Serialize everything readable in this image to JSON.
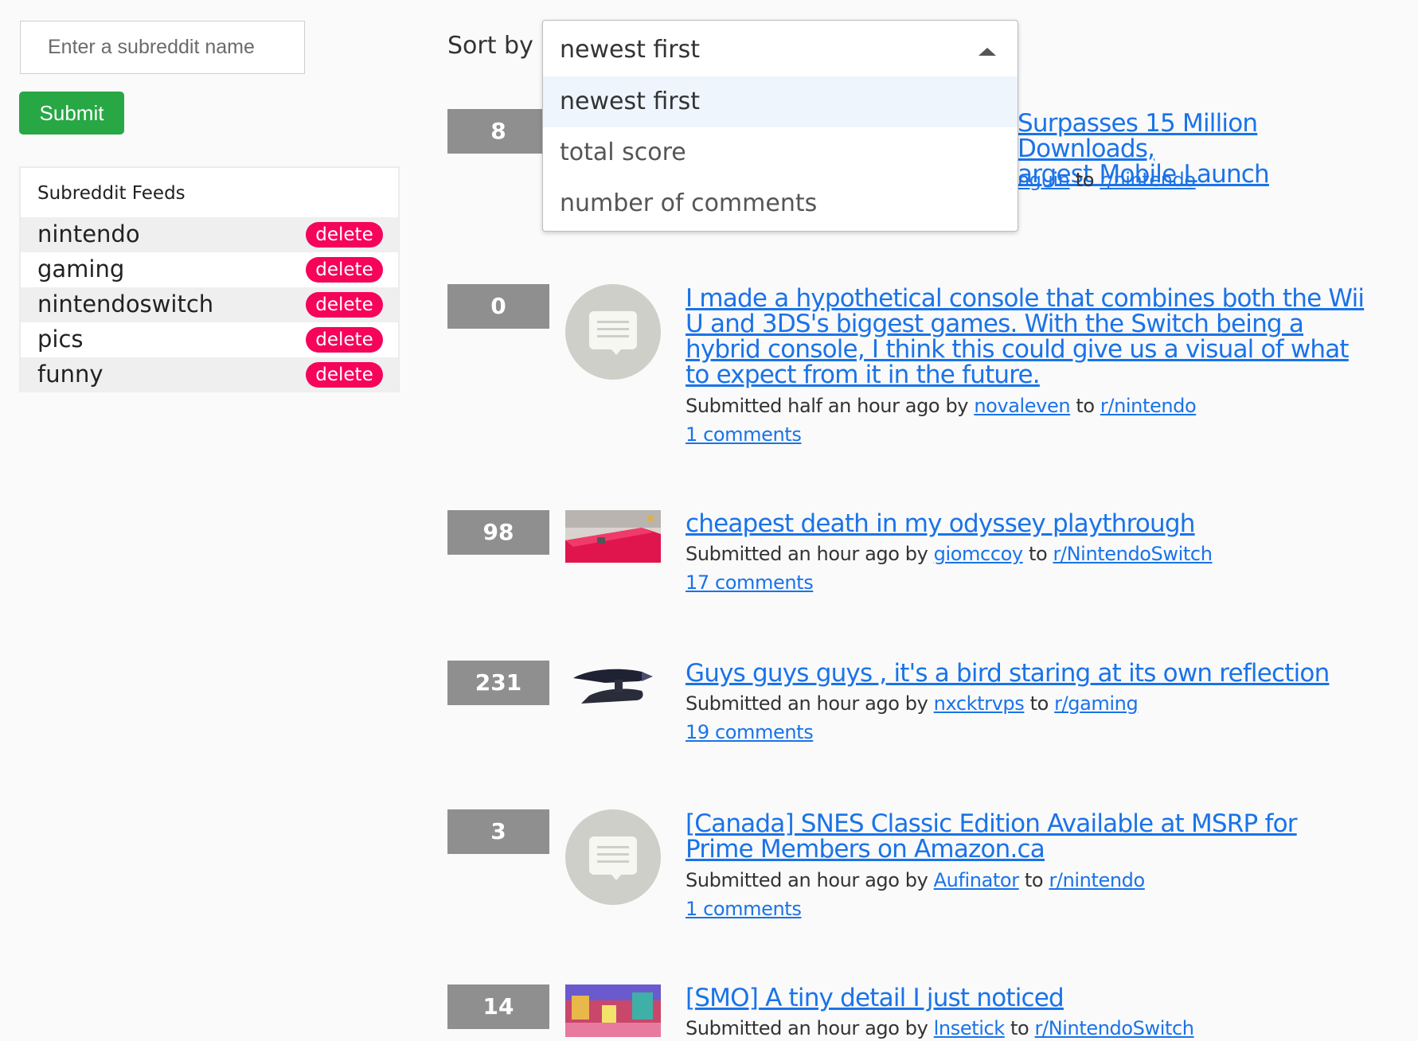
{
  "sidebar": {
    "input_placeholder": "Enter a subreddit name",
    "submit_label": "Submit",
    "feeds_title": "Subreddit Feeds",
    "delete_label": "delete",
    "feeds": [
      "nintendo",
      "gaming",
      "nintendoswitch",
      "pics",
      "funny"
    ]
  },
  "sort": {
    "label": "Sort by",
    "selected": "newest first",
    "options": [
      "newest first",
      "total score",
      "number of comments"
    ]
  },
  "colors": {
    "link": "#1a73e8",
    "submit": "#28a745",
    "delete": "#f5045a",
    "score_bg": "#8f8f8f"
  },
  "posts": [
    {
      "score": "8",
      "title_line1": "Surpasses 15 Million Downloads,",
      "title_line2": "argest Mobile Launch",
      "author": "nguin",
      "to": "to",
      "subreddit": "r/nintendo"
    },
    {
      "score": "0",
      "title": "I made a hypothetical console that combines both the Wii U and 3DS's biggest games. With the Switch being a hybrid console, I think this could give us a visual of what to expect from it in the future.",
      "submitted": "Submitted half an hour ago by",
      "author": "novaleven",
      "to": "to",
      "subreddit": "r/nintendo",
      "comments": "1 comments",
      "thumb": "text-post-icon"
    },
    {
      "score": "98",
      "title": "cheapest death in my odyssey playthrough",
      "submitted": "Submitted an hour ago by",
      "author": "giomccoy",
      "to": "to",
      "subreddit": "r/NintendoSwitch",
      "comments": "17 comments",
      "thumb": "red-table-image"
    },
    {
      "score": "231",
      "title": "Guys guys guys , it's a bird staring at its own reflection",
      "submitted": "Submitted an hour ago by",
      "author": "nxcktrvps",
      "to": "to",
      "subreddit": "r/gaming",
      "comments": "19 comments",
      "thumb": "dark-object-image"
    },
    {
      "score": "3",
      "title": "[Canada] SNES Classic Edition Available at MSRP for Prime Members on Amazon.ca",
      "submitted": "Submitted an hour ago by",
      "author": "Aufinator",
      "to": "to",
      "subreddit": "r/nintendo",
      "comments": "1 comments",
      "thumb": "text-post-icon"
    },
    {
      "score": "14",
      "title": "[SMO] A tiny detail I just noticed",
      "submitted": "Submitted an hour ago by",
      "author": "lnsetick",
      "to": "to",
      "subreddit": "r/NintendoSwitch",
      "thumb": "game-screenshot-image"
    }
  ]
}
